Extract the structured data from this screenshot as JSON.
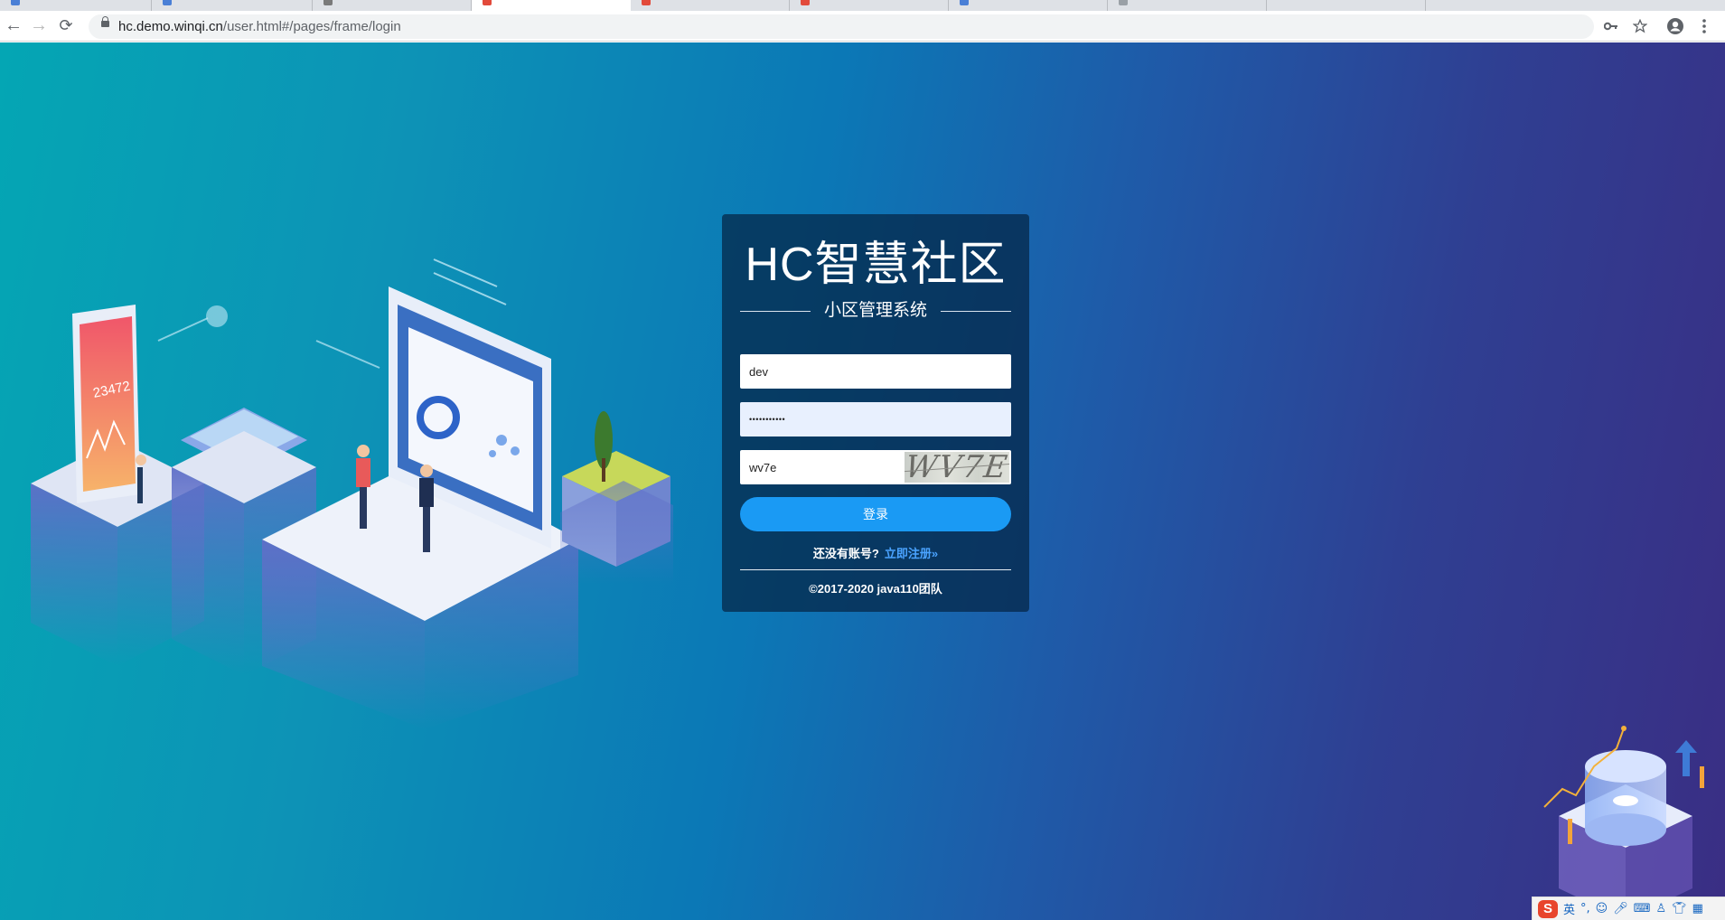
{
  "browser": {
    "url_host": "hc.demo.winqi.cn",
    "url_path": "/user.html#/pages/frame/login",
    "nav_back": "←",
    "nav_forward": "→",
    "nav_reload": "⟳",
    "icons": [
      "key-icon",
      "star-icon",
      "account-icon",
      "menu-dots-icon"
    ]
  },
  "login": {
    "title": "HC智慧社区",
    "subtitle": "小区管理系统",
    "username_value": "dev",
    "password_dots": "•••••••••••",
    "captcha_value": "wv7e",
    "captcha_image_text": "WV7E",
    "login_button": "登录",
    "no_account_text": "还没有账号?",
    "register_link": "立即注册»",
    "copyright": "©2017-2020 java110团队"
  },
  "illustration": {
    "phone_number": "23472"
  },
  "ime": {
    "mode_label": "英",
    "punct": "°,"
  },
  "colors": {
    "accent_button": "#1a9af4",
    "link": "#4aa3ff",
    "card_bg": "rgba(4,36,68,0.72)"
  }
}
